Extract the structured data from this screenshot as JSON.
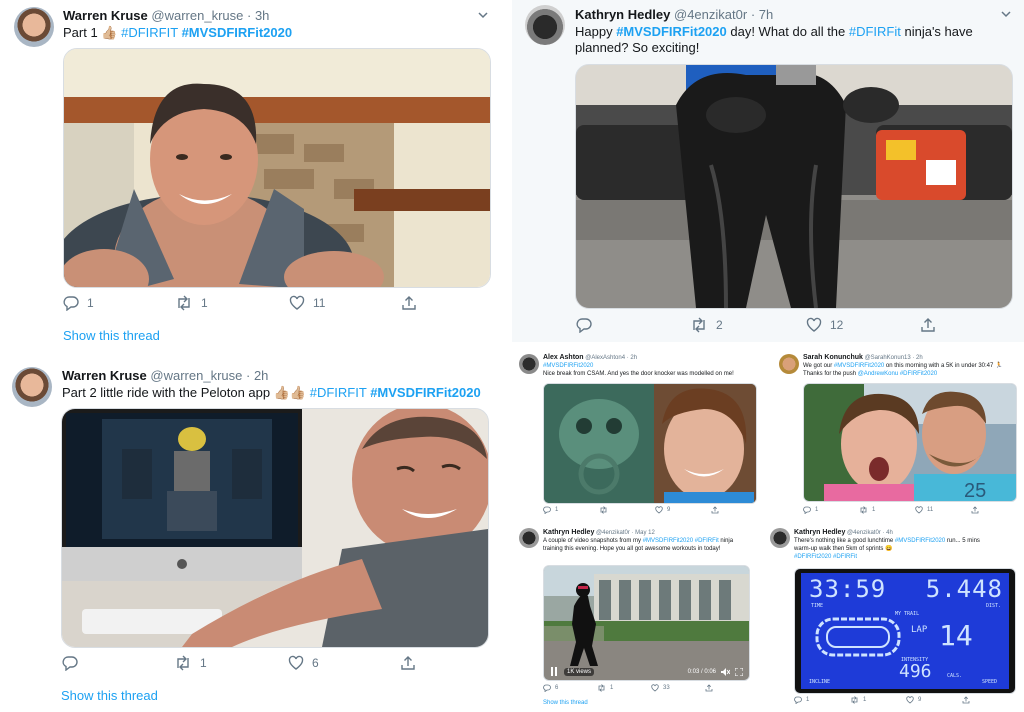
{
  "tweet1": {
    "name": "Warren Kruse",
    "handle": "@warren_kruse",
    "dot": "·",
    "time": "3h",
    "text": "Part 1 ",
    "emoji": "👍🏼",
    "tag1": "#DFIRFIT",
    "tag2": "#MVSDFIRFit2020",
    "replies": "1",
    "retweets": "1",
    "likes": "11",
    "thread_link": "Show this thread"
  },
  "tweet2": {
    "name": "Kathryn Hedley",
    "handle": "@4enzikat0r",
    "dot": "·",
    "time": "7h",
    "text_pre": "Happy ",
    "tag1": "#MVSDFIRFit2020",
    "text_mid": " day! What do all the ",
    "tag2": "#DFIRFit",
    "text_post": " ninja's have",
    "text_line2": "planned? So exciting!",
    "retweets": "2",
    "likes": "12"
  },
  "tweet3": {
    "name": "Warren Kruse",
    "handle": "@warren_kruse",
    "dot": "·",
    "time": "2h",
    "text": "Part 2 little ride with the Peloton app ",
    "emoji": "👍🏼👍🏼",
    "tag1": "#DFIRFIT",
    "tag2": "#MVSDFIRFit2020",
    "retweets": "1",
    "likes": "6",
    "thread_link": "Show this thread"
  },
  "tweet4": {
    "name": "Alex Ashton",
    "handle": "@AlexAshton4",
    "time": "· 2h",
    "tag": "#MVSDFIRFit2020",
    "text": "Nice break from CSAM. And yes the door knocker was modelled on me!",
    "replies": "1",
    "likes": "9"
  },
  "tweet5": {
    "name": "Sarah Konunchuk",
    "handle": "@SarahKonun13",
    "time": "· 2h",
    "text_pre": "We got our ",
    "tag1": "#MVSDFIRFit2020",
    "text_post": " on this morning with a 5K in under 30:47 🏃",
    "text_line2": "Thanks for the push ",
    "mention": "@AndrewKonu",
    "tag2": "#DFIRFit2020",
    "replies": "1",
    "retweets": "1",
    "likes": "11"
  },
  "tweet6": {
    "name": "Kathryn Hedley",
    "handle": "@4enzikat0r",
    "time": "· May 12",
    "text_pre": "A couple of video snapshots from my ",
    "tag1": "#MVSDFIRFit2020",
    "tag2": "#DFIRFit",
    "text_post": " ninja",
    "text_line2": "training this evening. Hope you all got awesome workouts in today!",
    "views": "1K views",
    "timecode": "0:03 / 0:06",
    "replies": "6",
    "retweets": "1",
    "likes": "33",
    "thread_link": "Show this thread"
  },
  "tweet7": {
    "name": "Kathryn Hedley",
    "handle": "@4enzikat0r",
    "time": "· 4h",
    "text_pre": "There's nothing like a good lunchtime ",
    "tag1": "#MVSDFIRFit2020",
    "text_post": " run... 5 mins",
    "text_line2": "warm-up walk then 5km of sprints 😄",
    "tag2": "#DFIRFit2020",
    "tag3": "#DFIRFit",
    "replies": "1",
    "retweets": "1",
    "likes": "9"
  },
  "treadmill": {
    "time": "33:59",
    "distance": "5.448",
    "time_label": "TIME",
    "dist_label": "DIST.",
    "track_label": "MY TRAIL",
    "lap_label": "LAP",
    "lap": "14",
    "intensity_label": "INTENSITY",
    "calories": "496",
    "cal_label": "CALS.",
    "incline_label": "INCLINE",
    "speed_label": "SPEED"
  },
  "colors": {
    "link": "#1da1f2",
    "muted": "#657786",
    "treadmill": "#1e3bd8"
  }
}
